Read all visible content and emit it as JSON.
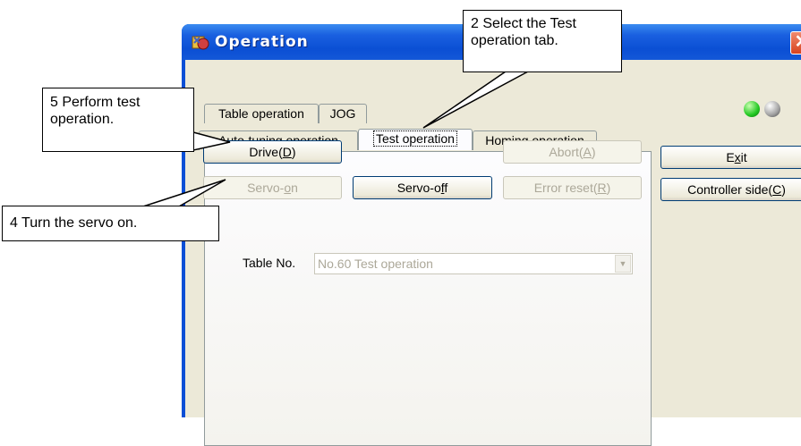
{
  "window": {
    "title": "Operation",
    "close_glyph": "✕",
    "icon": "operation-app-icon"
  },
  "tabs": {
    "row1": [
      "Table operation",
      "JOG"
    ],
    "row2": [
      "Auto-tuning operation",
      "Test operation",
      "Homing operation"
    ],
    "active": "Test operation"
  },
  "buttons": {
    "drive": {
      "pre": "Drive(",
      "key": "D",
      "post": ")"
    },
    "abort": {
      "pre": "Abort(",
      "key": "A",
      "post": ")"
    },
    "servo_on": {
      "pre": "Servo-",
      "key": "o",
      "post": "n"
    },
    "servo_off": {
      "pre": "Servo-o",
      "key": "f",
      "post": "f"
    },
    "error_reset": {
      "pre": "Error reset(",
      "key": "R",
      "post": ")"
    },
    "exit": {
      "pre": "E",
      "key": "x",
      "post": "it"
    },
    "controller_side": {
      "pre": "Controller side(",
      "key": "C",
      "post": ")"
    }
  },
  "table_no": {
    "label": "Table No.",
    "value": "No.60 Test operation"
  },
  "indicators": {
    "led1_color": "#22c822",
    "led2_color": "#a0a0a0"
  },
  "callouts": {
    "select_tab": "2 Select the Test operation tab.",
    "perform_test": "5 Perform test operation.",
    "servo_on": "4 Turn the servo on."
  }
}
